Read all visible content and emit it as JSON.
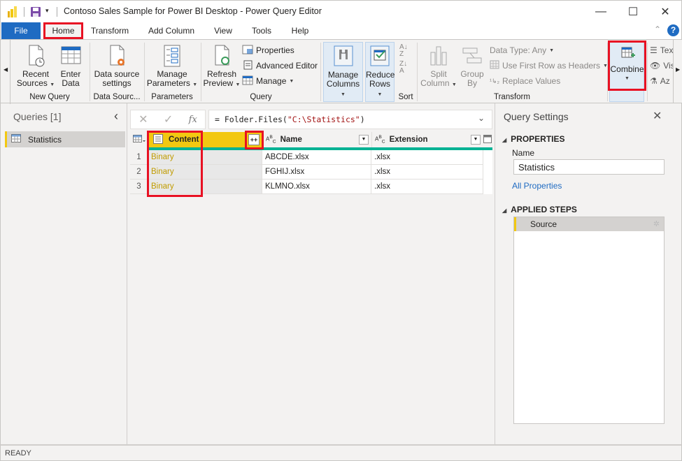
{
  "window": {
    "title": "Contoso Sales Sample for Power BI Desktop - Power Query Editor",
    "controls": {
      "minimize": "—",
      "maximize": "☐",
      "close": "✕"
    }
  },
  "tabs": [
    {
      "label": "File"
    },
    {
      "label": "Home",
      "active": true,
      "highlighted": true
    },
    {
      "label": "Transform"
    },
    {
      "label": "Add Column"
    },
    {
      "label": "View"
    },
    {
      "label": "Tools"
    },
    {
      "label": "Help"
    }
  ],
  "help_icon": "?",
  "ribbon": {
    "groups": {
      "new_query": {
        "label": "New Query",
        "recent_sources": [
          "Recent",
          "Sources"
        ],
        "enter_data": [
          "Enter",
          "Data"
        ]
      },
      "data_sources": {
        "label": "Data Sourc...",
        "settings": [
          "Data source",
          "settings"
        ]
      },
      "parameters": {
        "label": "Parameters",
        "manage": [
          "Manage",
          "Parameters"
        ]
      },
      "query": {
        "label": "Query",
        "refresh": [
          "Refresh",
          "Preview"
        ],
        "properties": "Properties",
        "advanced_editor": "Advanced Editor",
        "manage": "Manage"
      },
      "columns_rows": {
        "manage_columns": [
          "Manage",
          "Columns"
        ],
        "reduce_rows": [
          "Reduce",
          "Rows"
        ]
      },
      "sort": {
        "label": "Sort"
      },
      "transform": {
        "label": "Transform",
        "split_column": [
          "Split",
          "Column"
        ],
        "group_by": [
          "Group",
          "By"
        ],
        "data_type": "Data Type: Any",
        "use_first_row": "Use First Row as Headers",
        "replace_values": "Replace Values"
      },
      "combine": {
        "label": "Combine",
        "highlighted": true
      },
      "ai": {
        "text": "Tex",
        "vision": "Vis",
        "azure": "Az"
      }
    }
  },
  "queries_panel": {
    "title": "Queries [1]",
    "collapse_icon": "‹",
    "items": [
      {
        "label": "Statistics",
        "selected": true
      }
    ]
  },
  "formula_bar": {
    "cancel_icon": "✕",
    "commit_icon": "✓",
    "fx_label": "fx",
    "prefix": "= Folder.Files(",
    "string": "\"C:\\Statistics\"",
    "suffix": ")"
  },
  "grid": {
    "columns": [
      {
        "name": "Content",
        "type_icon": "binary",
        "highlighted": true,
        "expand_button": "++"
      },
      {
        "name": "Name",
        "type_icon": "ABC"
      },
      {
        "name": "Extension",
        "type_icon": "ABC"
      }
    ],
    "rows": [
      {
        "index": "1",
        "content": "Binary",
        "name": "ABCDE.xlsx",
        "extension": ".xlsx"
      },
      {
        "index": "2",
        "content": "Binary",
        "name": "FGHIJ.xlsx",
        "extension": ".xlsx"
      },
      {
        "index": "3",
        "content": "Binary",
        "name": "KLMNO.xlsx",
        "extension": ".xlsx"
      }
    ]
  },
  "query_settings": {
    "title": "Query Settings",
    "properties_header": "PROPERTIES",
    "name_label": "Name",
    "name_value": "Statistics",
    "all_properties_link": "All Properties",
    "applied_steps_header": "APPLIED STEPS",
    "steps": [
      {
        "label": "Source"
      }
    ]
  },
  "status": {
    "text": "READY"
  },
  "colors": {
    "file_tab": "#1f6bc2",
    "highlight_red": "#e81123",
    "content_header": "#f2c811",
    "binary_text": "#c19c00",
    "teal_bar": "#00b294",
    "link": "#1f6bc2"
  }
}
